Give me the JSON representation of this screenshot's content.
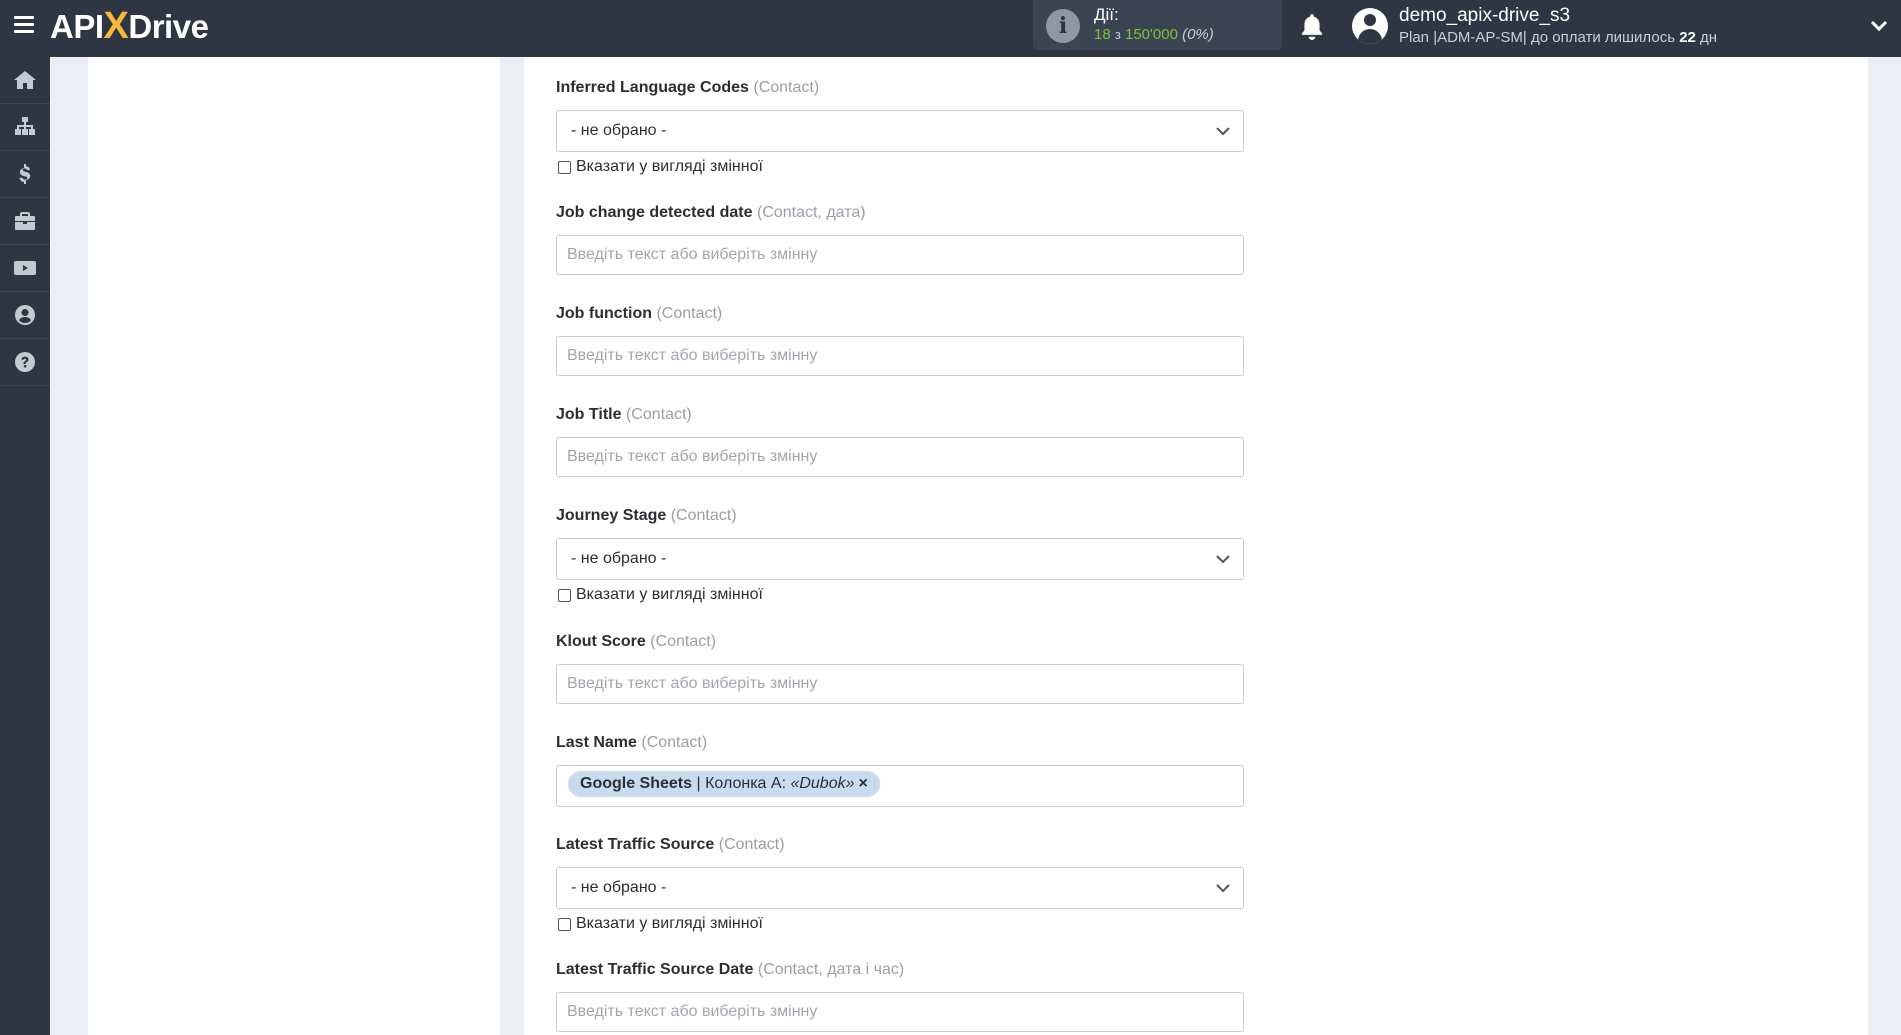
{
  "header": {
    "logo_left": "API",
    "logo_x": "X",
    "logo_right": "Drive",
    "actions_label": "Дії:",
    "actions_used": "18",
    "actions_of": "з",
    "actions_total": "150'000",
    "actions_percent": "(0%)",
    "user_name": "demo_apix-drive_s3",
    "plan_text": "Plan |ADM-AP-SM| до оплати лишилось",
    "plan_days": "22",
    "plan_unit": "дн"
  },
  "sidebar": {
    "items": [
      "home-icon",
      "sitemap-icon",
      "dollar-icon",
      "briefcase-icon",
      "youtube-icon",
      "user-circle-icon",
      "help-icon"
    ]
  },
  "form": {
    "checkbox_label": "Вказати у вигляді змінної",
    "select_placeholder": "- не обрано -",
    "input_placeholder": "Введіть текст або виберіть змінну",
    "fields": [
      {
        "label": "Inferred Language Codes",
        "hint": "(Contact)"
      },
      {
        "label": "Job change detected date",
        "hint": "(Contact, дата)"
      },
      {
        "label": "Job function",
        "hint": "(Contact)"
      },
      {
        "label": "Job Title",
        "hint": "(Contact)"
      },
      {
        "label": "Journey Stage",
        "hint": "(Contact)"
      },
      {
        "label": "Klout Score",
        "hint": "(Contact)"
      },
      {
        "label": "Last Name",
        "hint": "(Contact)"
      },
      {
        "label": "Latest Traffic Source",
        "hint": "(Contact)"
      },
      {
        "label": "Latest Traffic Source Date",
        "hint": "(Contact, дата і час)"
      }
    ],
    "last_name_tag": {
      "source": "Google Sheets",
      "separator": " | ",
      "column": "Колонка А: ",
      "value": "«Dubok»",
      "remove": "×"
    }
  }
}
